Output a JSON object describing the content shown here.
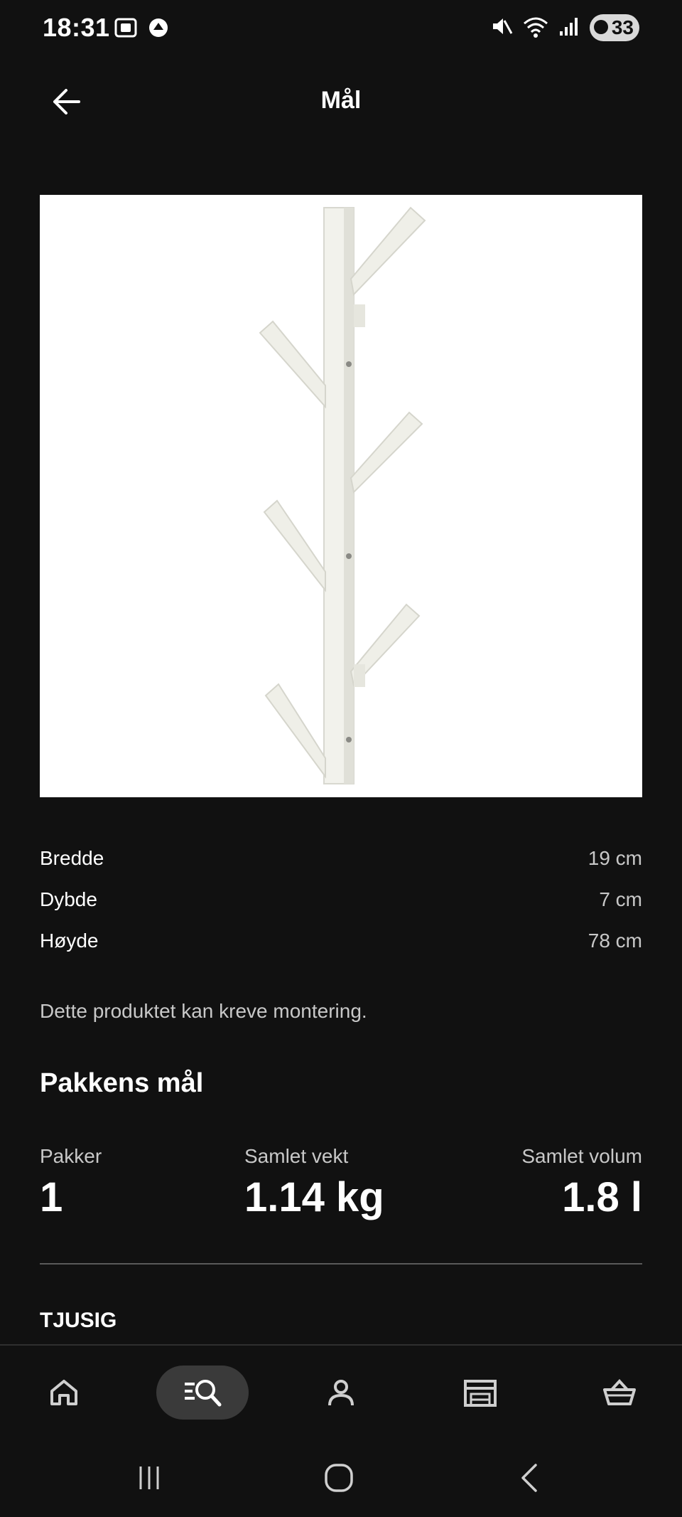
{
  "status_bar": {
    "time": "18:31",
    "battery": "33",
    "left_icons": [
      "screenshot-icon",
      "sync-icon"
    ],
    "right_icons": [
      "mute-icon",
      "wifi-icon",
      "signal-icon",
      "battery-icon"
    ]
  },
  "header": {
    "title": "Mål",
    "back_icon": "arrow-left-icon"
  },
  "product_image": {
    "subject": "white wall coat rack",
    "background": "#ffffff"
  },
  "dimensions": [
    {
      "label": "Bredde",
      "value": "19 cm"
    },
    {
      "label": "Dybde",
      "value": "7 cm"
    },
    {
      "label": "Høyde",
      "value": "78 cm"
    }
  ],
  "assembly_note": "Dette produktet kan kreve montering.",
  "package": {
    "title": "Pakkens mål",
    "items": [
      {
        "label": "Pakker",
        "value": "1"
      },
      {
        "label": "Samlet vekt",
        "value": "1.14 kg"
      },
      {
        "label": "Samlet volum",
        "value": "1.8 l"
      }
    ]
  },
  "product_name": "TJUSIG",
  "bottom_nav": {
    "items": [
      "home-icon",
      "search-list-icon",
      "profile-icon",
      "store-icon",
      "basket-icon"
    ],
    "active": "search-list-icon"
  },
  "system_nav": [
    "recents-icon",
    "home-circle-icon",
    "back-chevron-icon"
  ],
  "colors": {
    "background": "#111111",
    "text": "#ffffff",
    "muted_text": "#c8c8c8",
    "divider": "#5a5a5a",
    "active_nav_bg": "#3a3a3a"
  }
}
